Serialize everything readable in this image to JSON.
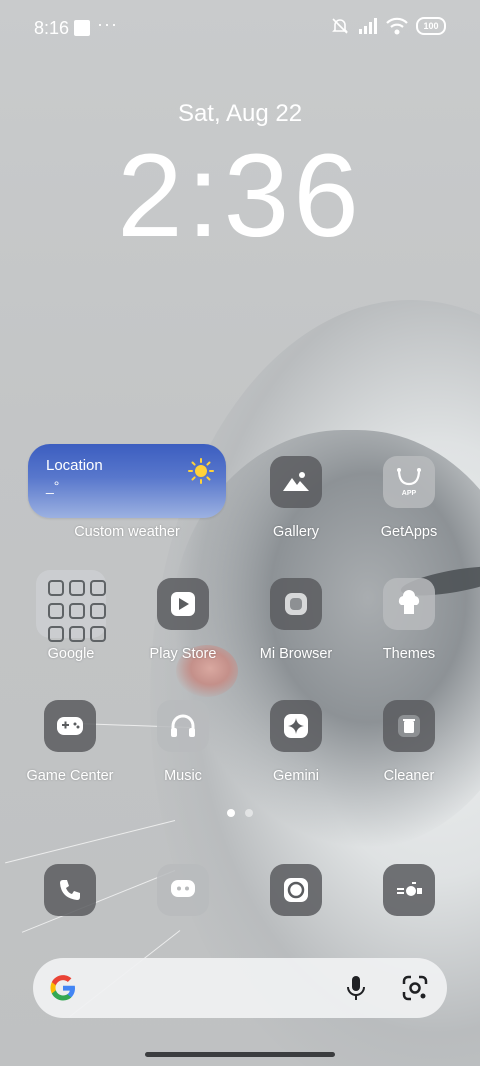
{
  "status_bar": {
    "time": "8:16",
    "more": "···",
    "battery": "100",
    "icons": [
      "mute-icon",
      "signal-icon",
      "wifi-icon",
      "battery-icon"
    ]
  },
  "lock": {
    "date": "Sat, Aug 22",
    "time": "2:36"
  },
  "weather_widget": {
    "location": "Location",
    "temperature": "_°",
    "caption": "Custom weather",
    "icon": "sun-icon"
  },
  "apps": {
    "gallery": "Gallery",
    "getapps": "GetApps",
    "google": "Google",
    "play_store": "Play Store",
    "mi_browser": "Mi Browser",
    "themes": "Themes",
    "game_center": "Game Center",
    "music": "Music",
    "gemini": "Gemini",
    "cleaner": "Cleaner"
  },
  "getapps_badge": "APP",
  "page_indicator": {
    "count": 2,
    "current": 1
  },
  "colors": {
    "accent_weather": "#3c5ec0",
    "icon_dark": "#5a5c5f"
  }
}
